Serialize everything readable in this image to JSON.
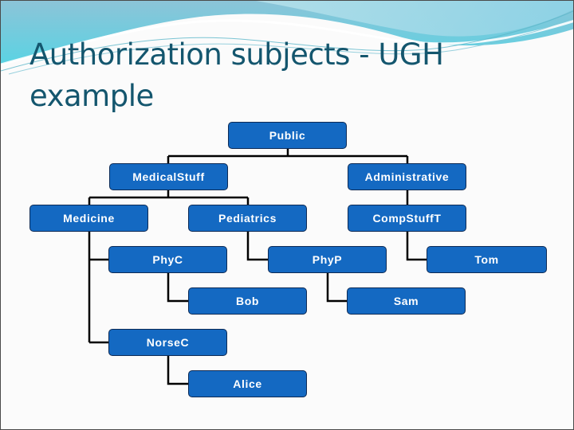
{
  "slide": {
    "title": "Authorization subjects - UGH example"
  },
  "colors": {
    "title": "#14566e",
    "node_fill": "#1469c2",
    "node_border": "#0d2a55",
    "node_text": "#ffffff",
    "connector": "#000000"
  },
  "hierarchy": {
    "public": "Public",
    "medical_stuff": "MedicalStuff",
    "administrative": "Administrative",
    "medicine": "Medicine",
    "pediatrics": "Pediatrics",
    "comp_stuff_t": "CompStuffT",
    "phy_c": "PhyC",
    "phy_p": "PhyP",
    "tom": "Tom",
    "bob": "Bob",
    "sam": "Sam",
    "norse_c": "NorseC",
    "alice": "Alice"
  },
  "edges": [
    [
      "Public",
      "MedicalStuff"
    ],
    [
      "Public",
      "Administrative"
    ],
    [
      "MedicalStuff",
      "Medicine"
    ],
    [
      "MedicalStuff",
      "Pediatrics"
    ],
    [
      "Administrative",
      "CompStuffT"
    ],
    [
      "Medicine",
      "PhyC"
    ],
    [
      "Medicine",
      "NorseC"
    ],
    [
      "Pediatrics",
      "PhyP"
    ],
    [
      "CompStuffT",
      "Tom"
    ],
    [
      "PhyC",
      "Bob"
    ],
    [
      "PhyP",
      "Sam"
    ],
    [
      "NorseC",
      "Alice"
    ]
  ]
}
